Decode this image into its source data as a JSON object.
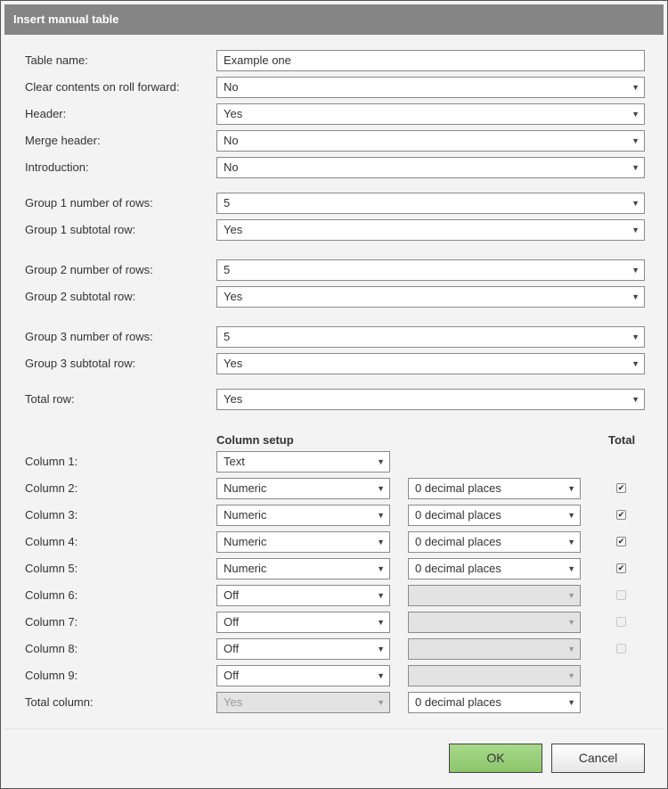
{
  "dialog": {
    "title": "Insert manual table"
  },
  "fields": {
    "table_name": {
      "label": "Table name:",
      "value": "Example one"
    },
    "clear_contents": {
      "label": "Clear contents on roll forward:",
      "value": "No"
    },
    "header": {
      "label": "Header:",
      "value": "Yes"
    },
    "merge_header": {
      "label": "Merge header:",
      "value": "No"
    },
    "introduction": {
      "label": "Introduction:",
      "value": "No"
    },
    "group1_rows": {
      "label": "Group 1 number of rows:",
      "value": "5"
    },
    "group1_subtotal": {
      "label": "Group 1 subtotal row:",
      "value": "Yes"
    },
    "group2_rows": {
      "label": "Group 2 number of rows:",
      "value": "5"
    },
    "group2_subtotal": {
      "label": "Group 2 subtotal row:",
      "value": "Yes"
    },
    "group3_rows": {
      "label": "Group 3 number of rows:",
      "value": "5"
    },
    "group3_subtotal": {
      "label": "Group 3 subtotal row:",
      "value": "Yes"
    },
    "total_row": {
      "label": "Total row:",
      "value": "Yes"
    }
  },
  "columns_section": {
    "setup_header": "Column setup",
    "total_header": "Total",
    "columns": [
      {
        "label": "Column 1:",
        "type": "Text",
        "format": null,
        "total": null
      },
      {
        "label": "Column 2:",
        "type": "Numeric",
        "format": "0 decimal places",
        "total": true
      },
      {
        "label": "Column 3:",
        "type": "Numeric",
        "format": "0 decimal places",
        "total": true
      },
      {
        "label": "Column 4:",
        "type": "Numeric",
        "format": "0 decimal places",
        "total": true
      },
      {
        "label": "Column 5:",
        "type": "Numeric",
        "format": "0 decimal places",
        "total": true
      },
      {
        "label": "Column 6:",
        "type": "Off",
        "format": "",
        "total": false
      },
      {
        "label": "Column 7:",
        "type": "Off",
        "format": "",
        "total": false
      },
      {
        "label": "Column 8:",
        "type": "Off",
        "format": "",
        "total": false
      },
      {
        "label": "Column 9:",
        "type": "Off",
        "format": "",
        "total": null
      }
    ],
    "total_column": {
      "label": "Total column:",
      "value": "Yes",
      "format": "0 decimal places"
    }
  },
  "buttons": {
    "ok": "OK",
    "cancel": "Cancel"
  },
  "icons": {
    "dropdown": "▼",
    "check": "✔"
  },
  "colors": {
    "titlebar": "#858585",
    "ok_button": "#98cd78",
    "background": "#f3f3f3"
  }
}
